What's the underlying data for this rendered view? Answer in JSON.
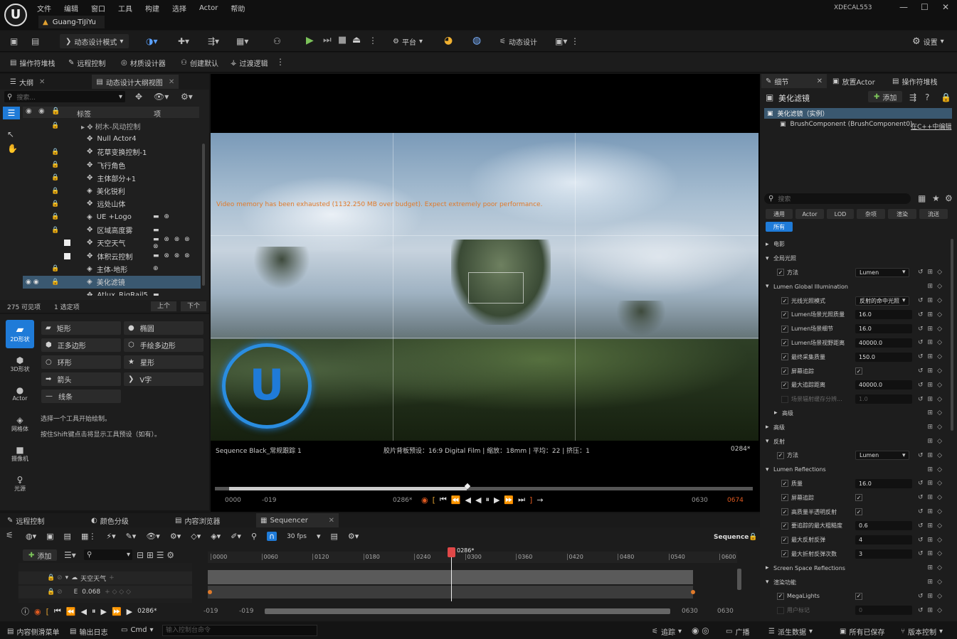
{
  "window": {
    "project_tab": "Guang-TiJiYu",
    "user": "XDECAL553"
  },
  "menu": [
    "文件",
    "编辑",
    "窗口",
    "工具",
    "构建",
    "选择",
    "Actor",
    "帮助"
  ],
  "toolbar1": {
    "mode": "动态设计模式",
    "platform": "平台",
    "motion_design": "动态设计",
    "settings": "设置"
  },
  "toolbar2": [
    "操作符堆栈",
    "远程控制",
    "材质设计器",
    "创建默认",
    "过渡逻辑"
  ],
  "outliner": {
    "tabs": [
      "大纲",
      "动态设计大纲视图"
    ],
    "search_placeholder": "搜索...",
    "col_label": "标签",
    "col_item": "项",
    "rows": [
      {
        "name": "Null Actor4",
        "lock": false,
        "extra": ""
      },
      {
        "name": "花草变换控制-1",
        "lock": true,
        "extra": ""
      },
      {
        "name": "飞行角色",
        "lock": true,
        "extra": ""
      },
      {
        "name": "主体部分+1",
        "lock": true,
        "extra": ""
      },
      {
        "name": "美化锐利",
        "lock": true,
        "extra": ""
      },
      {
        "name": "远处山体",
        "lock": true,
        "extra": ""
      },
      {
        "name": "UE +Logo",
        "lock": true,
        "extra": "▬ ⊕"
      },
      {
        "name": "区域高度雾",
        "lock": true,
        "extra": "▬"
      },
      {
        "name": "天空天气",
        "lock": false,
        "extra": "▬ ⊗ ⊗ ⊗ ⊗"
      },
      {
        "name": "体积云控制",
        "lock": false,
        "extra": "▬ ⊗ ⊗ ⊗"
      },
      {
        "name": "主体-地形",
        "lock": true,
        "extra": "⊕"
      },
      {
        "name": "美化滤镜",
        "lock": true,
        "extra": "",
        "selected": true
      },
      {
        "name": "Atlux_RigRail5",
        "lock": false,
        "extra": "▬"
      }
    ],
    "footer": {
      "visible": "275 可见项",
      "selected": "1 选定项",
      "up": "上个",
      "down": "下个"
    }
  },
  "shapes": {
    "categories": [
      "2D形状",
      "3D形状",
      "Actor",
      "网格体",
      "摄像机",
      "光源"
    ],
    "tools": [
      "矩形",
      "椭圆",
      "正多边形",
      "手绘多边形",
      "环形",
      "星形",
      "箭头",
      "V字",
      "线条"
    ],
    "hint1": "选择一个工具开始绘制。",
    "hint2": "按住Shift键点击将显示工具预设（如有）。"
  },
  "viewport": {
    "warning": "Video memory has been exhausted (1132.250 MB over budget). Expect extremely poor performance.",
    "sequence": "Sequence Black_常规跟踪 1",
    "info": "胶片背板预设：16:9 Digital Film | 缩放：18mm | 平均：22 | 挤压：1",
    "frame": "0284*",
    "tl_start": "0000",
    "tl_startneg": "-019",
    "tl_cur": "0286*",
    "tl_end1": "0630",
    "tl_end2": "0674"
  },
  "bottom_tabs": [
    "远程控制",
    "颜色分级",
    "内容浏览器",
    "Sequencer"
  ],
  "sequencer": {
    "fps": "30 fps",
    "label": "Sequence",
    "add": "添加",
    "marker": "0286*",
    "ticks": [
      "0000",
      "0060",
      "0120",
      "0180",
      "0240",
      "0300",
      "0360",
      "0420",
      "0480",
      "0540",
      "0600"
    ],
    "track1": "天空天气",
    "track2_value": "0.068",
    "cur": "0286*",
    "start": "-019",
    "startb": "-019",
    "end": "0630",
    "endb": "0630"
  },
  "details": {
    "tabs": [
      "细节",
      "放置Actor",
      "操作符堆栈"
    ],
    "title": "美化滤镜",
    "add": "添加",
    "instance": "美化滤镜（实例）",
    "component": "BrushComponent (BrushComponent0)",
    "edit_cpp": "在C++中编辑",
    "search_placeholder": "搜索",
    "cats": [
      "通用",
      "Actor",
      "LOD",
      "杂项",
      "渲染",
      "流送"
    ],
    "all": "所有",
    "rows": [
      {
        "t": "section",
        "label": "电影"
      },
      {
        "t": "section",
        "label": "全局光照",
        "open": true
      },
      {
        "t": "dd",
        "label": "方法",
        "value": "Lumen",
        "indent": 1
      },
      {
        "t": "section",
        "label": "Lumen Global Illumination",
        "open": true,
        "indent": 0
      },
      {
        "t": "dd",
        "label": "光线光照模式",
        "value": "反射的命中光照",
        "indent": 2
      },
      {
        "t": "num",
        "label": "Lumen场景光照质量",
        "value": "16.0",
        "indent": 2
      },
      {
        "t": "num",
        "label": "Lumen场景细节",
        "value": "16.0",
        "indent": 2
      },
      {
        "t": "num",
        "label": "Lumen场景视野距离",
        "value": "40000.0",
        "indent": 2
      },
      {
        "t": "num",
        "label": "最终采集质量",
        "value": "150.0",
        "indent": 2
      },
      {
        "t": "chk",
        "label": "屏幕追踪",
        "indent": 2
      },
      {
        "t": "num",
        "label": "最大追踪距离",
        "value": "40000.0",
        "indent": 2
      },
      {
        "t": "dim",
        "label": "场景辐射缓存分辨...",
        "value": "1.0",
        "indent": 2
      },
      {
        "t": "section",
        "label": "高级",
        "indent": 1
      },
      {
        "t": "section",
        "label": "高级"
      },
      {
        "t": "section",
        "label": "反射",
        "open": true
      },
      {
        "t": "dd",
        "label": "方法",
        "value": "Lumen",
        "indent": 1
      },
      {
        "t": "section",
        "label": "Lumen Reflections",
        "open": true
      },
      {
        "t": "num",
        "label": "质量",
        "value": "16.0",
        "indent": 2
      },
      {
        "t": "chk",
        "label": "屏幕追踪",
        "indent": 2
      },
      {
        "t": "chk",
        "label": "高质量半透明反射",
        "indent": 2
      },
      {
        "t": "num",
        "label": "要追踪的最大粗糙度",
        "value": "0.6",
        "indent": 2
      },
      {
        "t": "num",
        "label": "最大反射反弹",
        "value": "4",
        "indent": 2
      },
      {
        "t": "num",
        "label": "最大折射反弹次数",
        "value": "3",
        "indent": 2
      },
      {
        "t": "section",
        "label": "Screen Space Reflections"
      },
      {
        "t": "section",
        "label": "渲染功能",
        "open": true
      },
      {
        "t": "chk",
        "label": "MegaLights",
        "indent": 1
      },
      {
        "t": "dim",
        "label": "用户标记",
        "value": "0",
        "indent": 1
      }
    ]
  },
  "statusbar": {
    "left": [
      "内容侧滑菜单",
      "输出日志",
      "Cmd"
    ],
    "cmd_placeholder": "输入控制台命令",
    "right": [
      "追踪",
      "广播",
      "派生数据",
      "所有已保存",
      "版本控制"
    ]
  },
  "colors": {
    "accent": "#1f7bd8",
    "selected_row": "#3a5870",
    "warning": "#e07a2a"
  }
}
